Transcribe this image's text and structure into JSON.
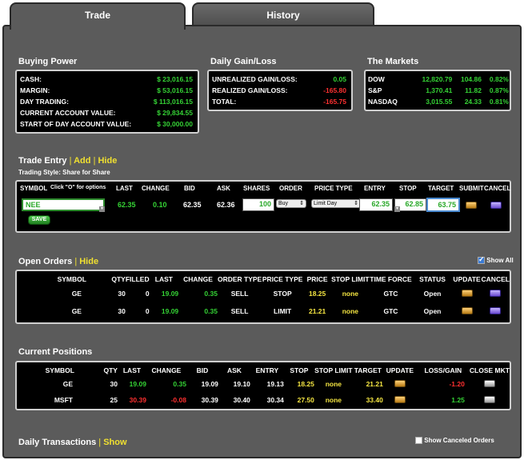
{
  "tabs": [
    "Trade",
    "History"
  ],
  "buying_power": {
    "title": "Buying Power",
    "rows": [
      {
        "label": "CASH:",
        "value": "$ 23,016.15"
      },
      {
        "label": "MARGIN:",
        "value": "$ 53,016.15"
      },
      {
        "label": "DAY TRADING:",
        "value": "$ 113,016.15"
      },
      {
        "label": "CURRENT ACCOUNT VALUE:",
        "value": "$ 29,834.55"
      },
      {
        "label": "START OF DAY ACCOUNT VALUE:",
        "value": "$ 30,000.00"
      }
    ]
  },
  "daily_gain": {
    "title": "Daily Gain/Loss",
    "rows": [
      {
        "label": "UNREALIZED GAIN/LOSS:",
        "value": "0.05"
      },
      {
        "label": "REALIZED GAIN/LOSS:",
        "value": "-165.80"
      },
      {
        "label": "TOTAL:",
        "value": "-165.75"
      }
    ]
  },
  "markets": {
    "title": "The Markets",
    "rows": [
      {
        "name": "DOW",
        "value": "12,820.79",
        "change": "104.86",
        "pct": "0.82%"
      },
      {
        "name": "S&P",
        "value": "1,370.41",
        "change": "11.82",
        "pct": "0.87%"
      },
      {
        "name": "NASDAQ",
        "value": "3,015.55",
        "change": "24.33",
        "pct": "0.81%"
      }
    ]
  },
  "trade_entry": {
    "title": "Trade Entry",
    "sep": "|",
    "add": "Add",
    "hide": "Hide",
    "style_label": "Trading Style: Share for Share",
    "headers": {
      "symbol": "SYMBOL",
      "hint": "Click \"O\" for options",
      "last": "LAST",
      "change": "CHANGE",
      "bid": "BID",
      "ask": "ASK",
      "shares": "SHARES",
      "order": "ORDER",
      "price_type": "PRICE TYPE",
      "entry": "ENTRY",
      "stop": "STOP",
      "target": "TARGET",
      "submit": "SUBMIT",
      "cancel": "CANCEL"
    },
    "row": {
      "symbol": "NEE",
      "last": "62.35",
      "change": "0.10",
      "bid": "62.35",
      "ask": "62.36",
      "shares": "100",
      "order": "Buy",
      "price_type": "Limit Day",
      "entry": "62.35",
      "stop": "62.85",
      "target": "63.75"
    },
    "save": "SAVE"
  },
  "open_orders": {
    "title": "Open Orders",
    "sep": "|",
    "hide": "Hide",
    "show_all": "Show All",
    "headers": [
      "SYMBOL",
      "QTY",
      "FILLED",
      "LAST",
      "CHANGE",
      "ORDER TYPE",
      "PRICE TYPE",
      "PRICE",
      "STOP LIMIT",
      "TIME FORCE",
      "STATUS",
      "UPDATE",
      "CANCEL"
    ],
    "rows": [
      {
        "symbol": "GE",
        "qty": "30",
        "filled": "0",
        "last": "19.09",
        "change": "0.35",
        "order_type": "SELL",
        "price_type": "STOP",
        "price": "18.25",
        "stop_limit": "none",
        "time_force": "GTC",
        "status": "Open"
      },
      {
        "symbol": "GE",
        "qty": "30",
        "filled": "0",
        "last": "19.09",
        "change": "0.35",
        "order_type": "SELL",
        "price_type": "LIMIT",
        "price": "21.21",
        "stop_limit": "none",
        "time_force": "GTC",
        "status": "Open"
      }
    ]
  },
  "positions": {
    "title": "Current Positions",
    "headers": [
      "SYMBOL",
      "QTY",
      "LAST",
      "CHANGE",
      "BID",
      "ASK",
      "ENTRY",
      "STOP",
      "STOP LIMIT",
      "TARGET",
      "UPDATE",
      "LOSS/GAIN",
      "CLOSE MKT"
    ],
    "rows": [
      {
        "symbol": "GE",
        "qty": "30",
        "last": "19.09",
        "change": "0.35",
        "bid": "19.09",
        "ask": "19.10",
        "entry": "19.13",
        "stop": "18.25",
        "stop_limit": "none",
        "target": "21.21",
        "gain": "-1.20"
      },
      {
        "symbol": "MSFT",
        "qty": "25",
        "last": "30.39",
        "change": "-0.08",
        "bid": "30.39",
        "ask": "30.40",
        "entry": "30.34",
        "stop": "27.50",
        "stop_limit": "none",
        "target": "33.40",
        "gain": "1.25"
      }
    ]
  },
  "daily_transactions": {
    "title": "Daily Transactions",
    "sep": "|",
    "show": "Show",
    "show_canceled": "Show Canceled Orders"
  },
  "colors": {
    "panel": "#5b5b5b",
    "green": "#35d335",
    "red": "#ff3030",
    "yellow": "#f5e642"
  }
}
